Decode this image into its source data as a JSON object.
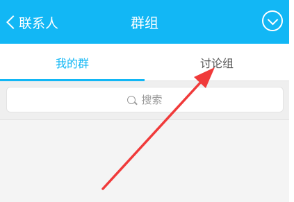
{
  "nav": {
    "back_label": "联系人",
    "title": "群组",
    "menu_icon": "chevron-down-circle-icon"
  },
  "tabs": [
    {
      "label": "我的群",
      "active": true
    },
    {
      "label": "讨论组",
      "active": false
    }
  ],
  "search": {
    "placeholder": "搜索"
  },
  "colors": {
    "accent": "#12b7f5",
    "annotation_arrow": "#f03a3a"
  }
}
